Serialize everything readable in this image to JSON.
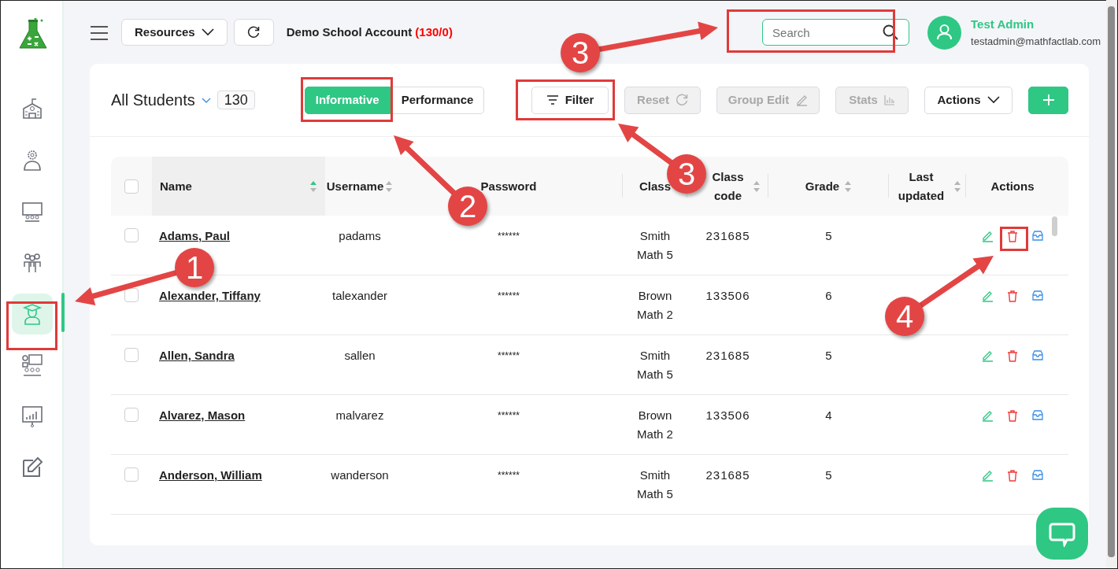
{
  "sidebar": {
    "items": [
      {
        "selected": false
      },
      {
        "selected": false
      },
      {
        "selected": false
      },
      {
        "selected": false
      },
      {
        "selected": true
      },
      {
        "selected": false
      },
      {
        "selected": false
      },
      {
        "selected": false
      }
    ]
  },
  "topbar": {
    "resources_button": "Resources",
    "account": "Demo School Account",
    "account_count": "(130/0)",
    "search": {
      "placeholder": "Search"
    },
    "user": {
      "name": "Test Admin",
      "email": "testadmin@mathfactlab.com"
    }
  },
  "toolbar": {
    "title": "All Students",
    "count": "130",
    "view_tabs": [
      {
        "label": "Informative",
        "selected": true
      },
      {
        "label": "Performance",
        "selected": false
      }
    ],
    "buttons": [
      {
        "kind": "filter",
        "label": "Filter",
        "disabled": false
      },
      {
        "kind": "reset",
        "label": "Reset",
        "disabled": true
      },
      {
        "kind": "group_edit",
        "label": "Group Edit",
        "disabled": true
      },
      {
        "kind": "stats",
        "label": "Stats",
        "disabled": true
      },
      {
        "kind": "actions",
        "label": "Actions",
        "disabled": false
      },
      {
        "kind": "add",
        "disabled": false
      }
    ]
  },
  "table": {
    "select_all": {
      "checked": false
    },
    "columns": [
      {
        "label": "Name",
        "sorted": true
      },
      {
        "label": "Username",
        "sorted": false
      },
      {
        "label": "Password"
      },
      {
        "label": "Class"
      },
      {
        "label": "Class code",
        "sorted": false
      },
      {
        "label": "Grade",
        "sorted": false
      },
      {
        "label": "Last updated",
        "sorted": false
      },
      {
        "label": "Actions"
      }
    ],
    "rows": [
      {
        "checked": false,
        "name": "Adams, Paul",
        "username": "padams",
        "password": "******",
        "class": "Smith Math 5",
        "class_code": "231685",
        "grade": "5"
      },
      {
        "checked": false,
        "name": "Alexander, Tiffany",
        "username": "talexander",
        "password": "******",
        "class": "Brown Math 2",
        "class_code": "133506",
        "grade": "6"
      },
      {
        "checked": false,
        "name": "Allen, Sandra",
        "username": "sallen",
        "password": "******",
        "class": "Smith Math 5",
        "class_code": "231685",
        "grade": "5"
      },
      {
        "checked": false,
        "name": "Alvarez, Mason",
        "username": "malvarez",
        "password": "******",
        "class": "Brown Math 2",
        "class_code": "133506",
        "grade": "4"
      },
      {
        "checked": false,
        "name": "Anderson, William",
        "username": "wanderson",
        "password": "******",
        "class": "Smith Math 5",
        "class_code": "231685",
        "grade": "5"
      }
    ]
  },
  "annotations": {
    "callouts": [
      "1",
      "2",
      "3",
      "3",
      "4"
    ]
  }
}
